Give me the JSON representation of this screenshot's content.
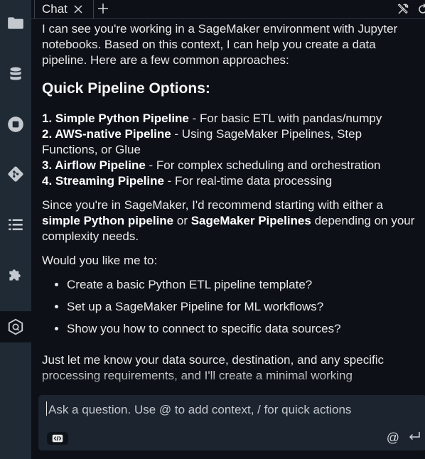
{
  "activity_bar": {
    "items": [
      {
        "icon": "folder-icon"
      },
      {
        "icon": "database-icon"
      },
      {
        "icon": "stop-circle-icon"
      },
      {
        "icon": "git-icon"
      },
      {
        "icon": "list-icon"
      },
      {
        "icon": "extension-puzzle-icon"
      },
      {
        "icon": "amazon-q-icon"
      }
    ]
  },
  "tabbar": {
    "tab_label": "Chat"
  },
  "message": {
    "intro": "I can see you're working in a SageMaker environment with Jupyter notebooks. Based on this context, I can help you create a data pipeline. Here are a few common approaches:",
    "heading": "Quick Pipeline Options:",
    "options": [
      {
        "bold": "1. Simple Python Pipeline",
        "rest": " - For basic ETL with pandas/numpy"
      },
      {
        "bold": "2. AWS-native Pipeline",
        "rest": " - Using SageMaker Pipelines, Step Functions, or Glue"
      },
      {
        "bold": "3. Airflow Pipeline",
        "rest": " - For complex scheduling and orchestration"
      },
      {
        "bold": "4. Streaming Pipeline",
        "rest": " - For real-time data processing"
      }
    ],
    "recommend_pre": "Since you're in SageMaker, I'd recommend starting with either a ",
    "recommend_b1": "simple Python pipeline",
    "recommend_mid": " or ",
    "recommend_b2": "SageMaker Pipelines",
    "recommend_post": " depending on your complexity needs.",
    "ask": "Would you like me to:",
    "asks": [
      "Create a basic Python ETL pipeline template?",
      "Set up a SageMaker Pipeline for ML workflows?",
      "Show you how to connect to specific data sources?"
    ],
    "closing": "Just let me know your data source, destination, and any specific processing requirements, and I'll create a minimal working"
  },
  "composer": {
    "placeholder": "Ask a question. Use @ to add context, / for quick actions",
    "at_label": "@"
  }
}
